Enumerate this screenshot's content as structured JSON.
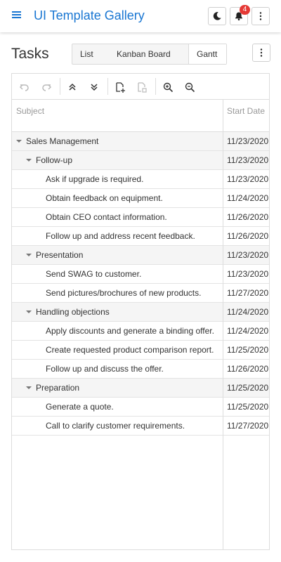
{
  "app": {
    "title": "UI Template Gallery",
    "notification_count": "4"
  },
  "icons": {
    "menu": "hamburger-menu-icon",
    "theme": "moon-icon",
    "notifications": "bell-icon",
    "more": "vertical-dots-icon"
  },
  "page": {
    "title": "Tasks"
  },
  "views": [
    {
      "label": "List",
      "selected": false
    },
    {
      "label": "Kanban Board",
      "selected": false
    },
    {
      "label": "Gantt",
      "selected": true
    }
  ],
  "toolbar": {
    "items": [
      "undo-icon",
      "redo-icon",
      "collapse-all-icon",
      "expand-all-icon",
      "add-task-icon",
      "delete-task-icon",
      "zoom-in-icon",
      "zoom-out-icon"
    ]
  },
  "columns": {
    "subject": "Subject",
    "start_date": "Start Date"
  },
  "tasks": [
    {
      "subject": "Sales Management",
      "start": "11/23/2020",
      "level": 0,
      "group": true
    },
    {
      "subject": "Follow-up",
      "start": "11/23/2020",
      "level": 1,
      "group": true
    },
    {
      "subject": "Ask if upgrade is required.",
      "start": "11/23/2020",
      "level": 2,
      "group": false
    },
    {
      "subject": "Obtain feedback on equipment.",
      "start": "11/24/2020",
      "level": 2,
      "group": false
    },
    {
      "subject": "Obtain CEO contact information.",
      "start": "11/26/2020",
      "level": 2,
      "group": false
    },
    {
      "subject": "Follow up and address recent feedback.",
      "start": "11/26/2020",
      "level": 2,
      "group": false
    },
    {
      "subject": "Presentation",
      "start": "11/23/2020",
      "level": 1,
      "group": true
    },
    {
      "subject": "Send SWAG to customer.",
      "start": "11/23/2020",
      "level": 2,
      "group": false
    },
    {
      "subject": "Send pictures/brochures of new products.",
      "start": "11/27/2020",
      "level": 2,
      "group": false
    },
    {
      "subject": "Handling objections",
      "start": "11/24/2020",
      "level": 1,
      "group": true
    },
    {
      "subject": "Apply discounts and generate a binding offer.",
      "start": "11/24/2020",
      "level": 2,
      "group": false
    },
    {
      "subject": "Create requested product comparison report.",
      "start": "11/25/2020",
      "level": 2,
      "group": false
    },
    {
      "subject": "Follow up and discuss the offer.",
      "start": "11/26/2020",
      "level": 2,
      "group": false
    },
    {
      "subject": "Preparation",
      "start": "11/25/2020",
      "level": 1,
      "group": true
    },
    {
      "subject": "Generate a quote.",
      "start": "11/25/2020",
      "level": 2,
      "group": false
    },
    {
      "subject": "Call to clarify customer requirements.",
      "start": "11/27/2020",
      "level": 2,
      "group": false
    }
  ],
  "colors": {
    "accent": "#1976d2",
    "badge": "#e53935",
    "group_row_bg": "#f5f5f5"
  }
}
